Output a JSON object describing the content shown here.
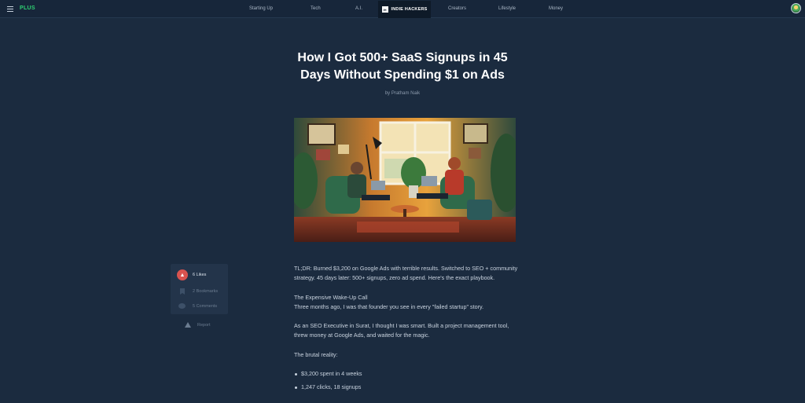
{
  "nav": {
    "plus_label": "PLUS",
    "items": [
      "Starting Up",
      "Tech",
      "A.I.",
      "Creators",
      "Lifestyle",
      "Money"
    ],
    "brand": {
      "logo_text": "IH",
      "name": "INDIE HACKERS"
    }
  },
  "article": {
    "title": "How I Got 500+ SaaS Signups in 45 Days Without Spending $1 on Ads",
    "byline": "by Pratham Naik",
    "hero_icon": "illustration-two-people-working-on-laptops",
    "paragraphs": {
      "tldr": "TL;DR: Burned $3,200 on Google Ads with terrible results. Switched to SEO + community strategy. 45 days later: 500+ signups, zero ad spend. Here's the exact playbook.",
      "heading": "The Expensive Wake-Up Call",
      "intro": "Three months ago, I was that founder you see in every \"failed startup\" story.",
      "story": "As an SEO Executive in Surat, I thought I was smart. Built a project management tool, threw money at Google Ads, and waited for the magic.",
      "reality": "The brutal reality:"
    },
    "bullets": [
      "$3,200 spent in 4 weeks",
      "1,247 clicks, 18 signups"
    ]
  },
  "actions": {
    "likes": "6 Likes",
    "bookmarks": "2 Bookmarks",
    "comments": "5 Comments",
    "report": "Report"
  },
  "colors": {
    "background": "#1b2b3f",
    "accent_green": "#2fd173",
    "like_red": "#d9534f"
  }
}
